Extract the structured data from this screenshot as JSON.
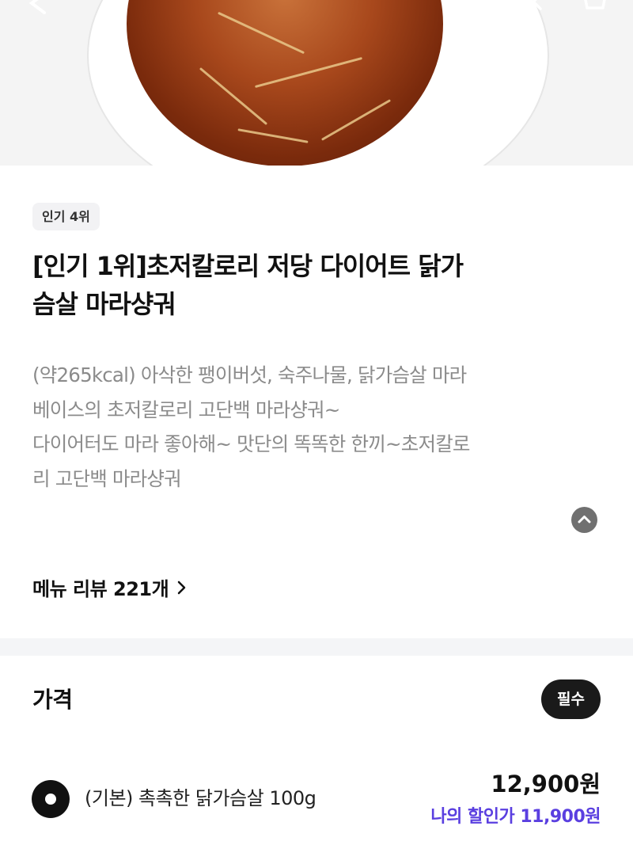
{
  "hero": {
    "icons": [
      "back-arrow-icon",
      "share-icon",
      "search-icon",
      "cart-icon"
    ]
  },
  "product": {
    "badge": "인기 4위",
    "title_line1": "[인기 1위]초저칼로리 저당 다이어트 닭가",
    "title_line2": "슴살 마라샹궈",
    "description": [
      "(약265kcal) 아삭한 팽이버섯, 숙주나물, 닭가슴살 마라",
      "베이스의 초저칼로리 고단백 마라샹궈~",
      "다이어터도 마라 좋아해~ 맛단의 똑똑한 한끼~초저칼로",
      "리 고단백 마라샹궈"
    ],
    "review_link": "메뉴 리뷰 221개"
  },
  "price_section": {
    "title": "가격",
    "required_badge": "필수",
    "options": [
      {
        "label": "(기본) 촉촉한 닭가슴살 100g",
        "price": "12,900원",
        "discount": "나의 할인가 11,900원",
        "selected": true
      }
    ]
  },
  "colors": {
    "accent_discount": "#5a3fe0",
    "dark": "#1a1a1a"
  }
}
